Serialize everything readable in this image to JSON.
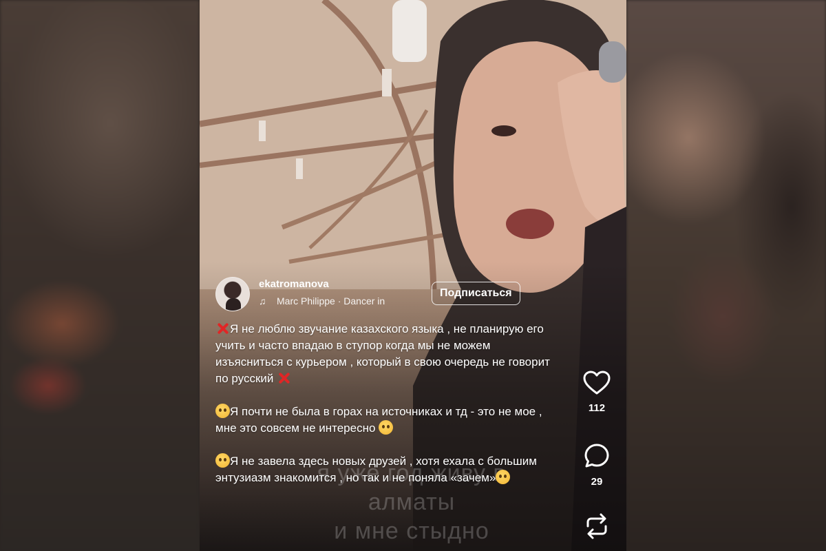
{
  "post": {
    "username": "ekatromanova",
    "music": "Marc Philippe · Dancer in",
    "subscribe_label": "Подписаться",
    "caption": [
      {
        "lead_emoji": "cross-mark",
        "text": "Я не люблю звучание  казахского языка , не планирую его учить и часто впадаю в ступор когда мы не можем изъясниться с курьером , который в свою очередь не говорит по  русский",
        "trail_emoji": "cross-mark"
      },
      {
        "lead_emoji": "melting-face",
        "text": "Я почти не была в горах на источниках и тд - это не мое , мне это совсем не интересно",
        "trail_emoji": "melting-face"
      },
      {
        "lead_emoji": "pleading-face",
        "text": "Я не завела здесь новых друзей , хотя ехала с большим энтузиазм знакомится , но так и не поняла «зачем»",
        "trail_emoji": "pleading-face"
      }
    ],
    "video_overlay": {
      "line1": "я уже год живу в",
      "line2": "алматы",
      "line3": "и мне стыдно"
    }
  },
  "actions": {
    "like_icon": "heart-icon",
    "likes": "112",
    "comment_icon": "comment-icon",
    "comments": "29",
    "share_icon": "repost-icon"
  },
  "colors": {
    "cross_mark": "#e02626",
    "text": "#ffffff"
  }
}
